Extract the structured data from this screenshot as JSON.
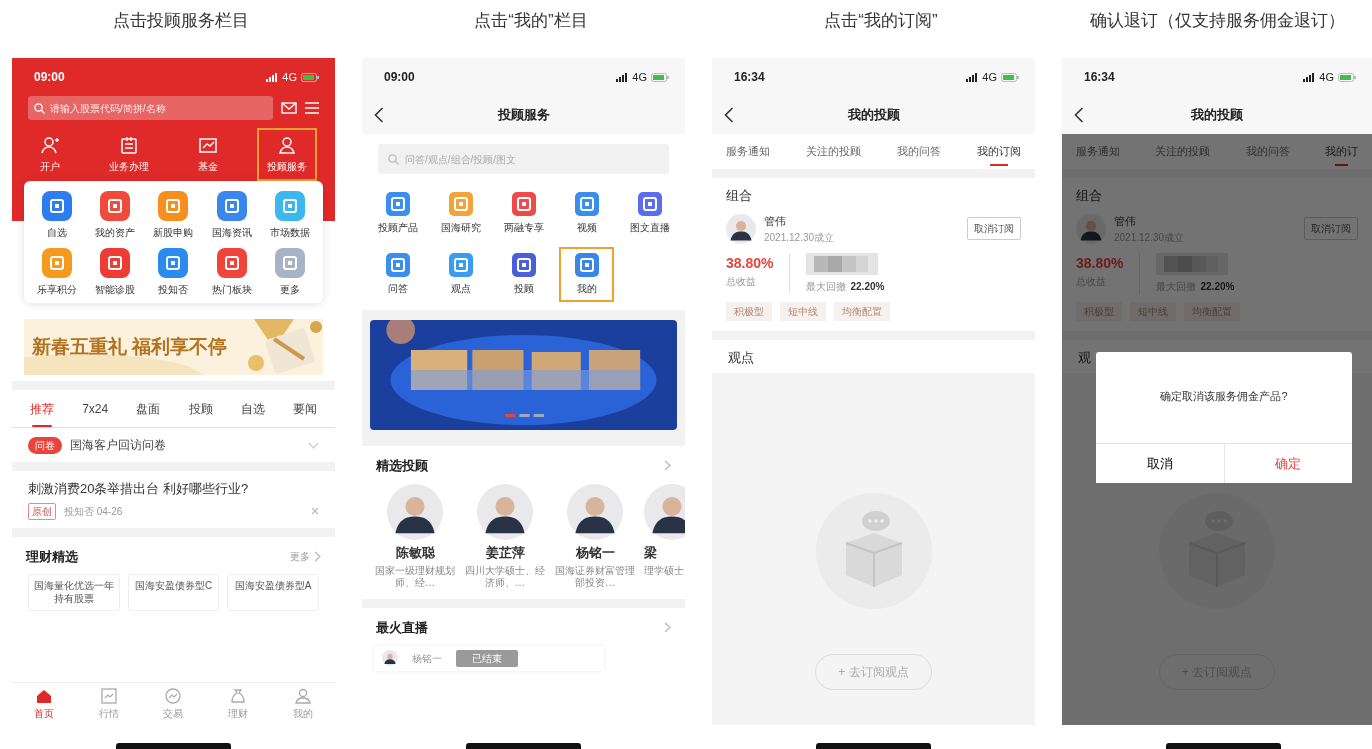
{
  "panels": [
    {
      "kind": "home",
      "caption": "点击投顾服务栏目",
      "time": "09:00",
      "network": "4G",
      "search_placeholder": "请输入股票代码/简拼/名称",
      "shortcuts": [
        {
          "label": "开户",
          "selected": false
        },
        {
          "label": "业务办理",
          "selected": false
        },
        {
          "label": "基金",
          "selected": false
        },
        {
          "label": "投顾服务",
          "selected": true
        }
      ],
      "apps": [
        {
          "label": "自选",
          "color": "#2f7cf0"
        },
        {
          "label": "我的资产",
          "color": "#f04a3c"
        },
        {
          "label": "新股申购",
          "color": "#f5901e"
        },
        {
          "label": "国海资讯",
          "color": "#3a86ec"
        },
        {
          "label": "市场数据",
          "color": "#3cb8ee"
        },
        {
          "label": "乐享积分",
          "color": "#f59a1e"
        },
        {
          "label": "智能诊股",
          "color": "#ee3b36"
        },
        {
          "label": "投知否",
          "color": "#2a8af0"
        },
        {
          "label": "热门板块",
          "color": "#f0443a"
        },
        {
          "label": "更多",
          "color": "#a9b3c8"
        }
      ],
      "banner_text": "新春五重礼 福利享不停",
      "feed_tabs": [
        {
          "label": "推荐",
          "selected": true
        },
        {
          "label": "7x24",
          "selected": false
        },
        {
          "label": "盘面",
          "selected": false
        },
        {
          "label": "投顾",
          "selected": false
        },
        {
          "label": "自选",
          "selected": false
        },
        {
          "label": "要闻",
          "selected": false
        }
      ],
      "notice": {
        "badge": "问卷",
        "text": "国海客户回访问卷"
      },
      "news": {
        "title": "刺激消费20条举措出台 利好哪些行业?",
        "tag": "原创",
        "meta": "投知否 04-26"
      },
      "section": {
        "title": "理财精选",
        "more": "更多"
      },
      "products": [
        "国海量化优选一年持有股票",
        "国海安盈债券型C",
        "国海安盈债券型A"
      ],
      "bottom_nav": [
        {
          "label": "首页",
          "selected": true
        },
        {
          "label": "行情",
          "selected": false
        },
        {
          "label": "交易",
          "selected": false
        },
        {
          "label": "理财",
          "selected": false
        },
        {
          "label": "我的",
          "selected": false
        }
      ]
    },
    {
      "kind": "service",
      "caption": "点击“我的”栏目",
      "time": "09:00",
      "network": "4G",
      "title": "投顾服务",
      "search_placeholder": "问答/观点/组合/投顾/图文",
      "features": [
        {
          "label": "投顾产品",
          "color": "#3a8ef0",
          "selected": false
        },
        {
          "label": "国海研究",
          "color": "#f2a33a",
          "selected": false
        },
        {
          "label": "两融专享",
          "color": "#ee4a4a",
          "selected": false
        },
        {
          "label": "视频",
          "color": "#3a8ef0",
          "selected": false
        },
        {
          "label": "图文直播",
          "color": "#5b6cf0",
          "selected": false
        },
        {
          "label": "问答",
          "color": "#3a8ef0",
          "selected": false
        },
        {
          "label": "观点",
          "color": "#3a9cf0",
          "selected": false
        },
        {
          "label": "投顾",
          "color": "#4a5fd8",
          "selected": false
        },
        {
          "label": "我的",
          "color": "#3a86e8",
          "selected": true
        }
      ],
      "featured_title": "精选投顾",
      "advisors": [
        {
          "name": "陈敏聪",
          "bio": "国家一级理财规划师、经…"
        },
        {
          "name": "姜芷萍",
          "bio": "四川大学硕士、经济师、…"
        },
        {
          "name": "杨铭一",
          "bio": "国海证券财富管理部投资…"
        },
        {
          "name": "梁",
          "bio": "理学硕士"
        }
      ],
      "live_title": "最火直播",
      "live": {
        "host": "杨铭一",
        "status": "已结束"
      }
    },
    {
      "kind": "mine",
      "caption": "点击“我的订阅”",
      "time": "16:34",
      "network": "4G",
      "title": "我的投顾",
      "tabs": [
        {
          "label": "服务通知",
          "selected": false
        },
        {
          "label": "关注的投顾",
          "selected": false
        },
        {
          "label": "我的问答",
          "selected": false
        },
        {
          "label": "我的订阅",
          "selected": true
        }
      ],
      "portfolio": {
        "heading": "组合",
        "manager": "管伟",
        "founded": "2021.12.30成立",
        "unsubscribe": "取消订阅",
        "return_value": "38.80%",
        "return_label": "总收益",
        "drawdown_label": "最大回撤",
        "drawdown_value": "22.20%",
        "tags": [
          "积极型",
          "短中线",
          "均衡配置"
        ]
      },
      "views": {
        "heading": "观点",
        "button": "+ 去订阅观点"
      }
    },
    {
      "kind": "mine",
      "caption": "确认退订（仅支持服务佣金退订）",
      "time": "16:34",
      "network": "4G",
      "title": "我的投顾",
      "tabs": [
        {
          "label": "服务通知",
          "selected": false
        },
        {
          "label": "关注的投顾",
          "selected": false
        },
        {
          "label": "我的问答",
          "selected": false
        },
        {
          "label": "我的订",
          "selected": true
        }
      ],
      "portfolio": {
        "heading": "组合",
        "manager": "管伟",
        "founded": "2021.12.30成立",
        "unsubscribe": "取消订阅",
        "return_value": "38.80%",
        "return_label": "总收益",
        "drawdown_label": "最大回撤",
        "drawdown_value": "22.20%",
        "tags": [
          "积极型",
          "短中线",
          "均衡配置"
        ]
      },
      "views": {
        "heading": "观",
        "button": "+ 去订阅观点"
      },
      "dialog": {
        "message": "确定取消该服务佣金产品?",
        "cancel": "取消",
        "confirm": "确定"
      }
    }
  ]
}
